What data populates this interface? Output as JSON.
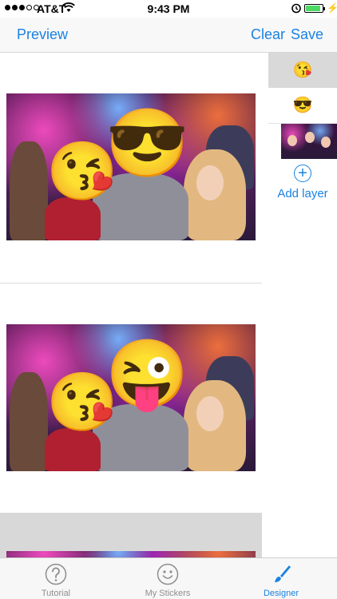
{
  "status_bar": {
    "carrier": "AT&T",
    "time": "9:43 PM",
    "battery_level": 0.9
  },
  "nav": {
    "preview": "Preview",
    "clear": "Clear",
    "save": "Save"
  },
  "cells": [
    {
      "emoji_main": "😎",
      "emoji_kiss": "😘"
    },
    {
      "emoji_main": "😜",
      "emoji_kiss": "😘"
    }
  ],
  "layers": {
    "items": [
      "😘",
      "😎"
    ],
    "add_label": "Add layer",
    "add_symbol": "+"
  },
  "tabs": [
    {
      "label": "Tutorial"
    },
    {
      "label": "My Stickers"
    },
    {
      "label": "Designer"
    }
  ],
  "colors": {
    "accent": "#1a82e2",
    "inactive_tab": "#8e8e8e",
    "battery": "#4cd964"
  }
}
